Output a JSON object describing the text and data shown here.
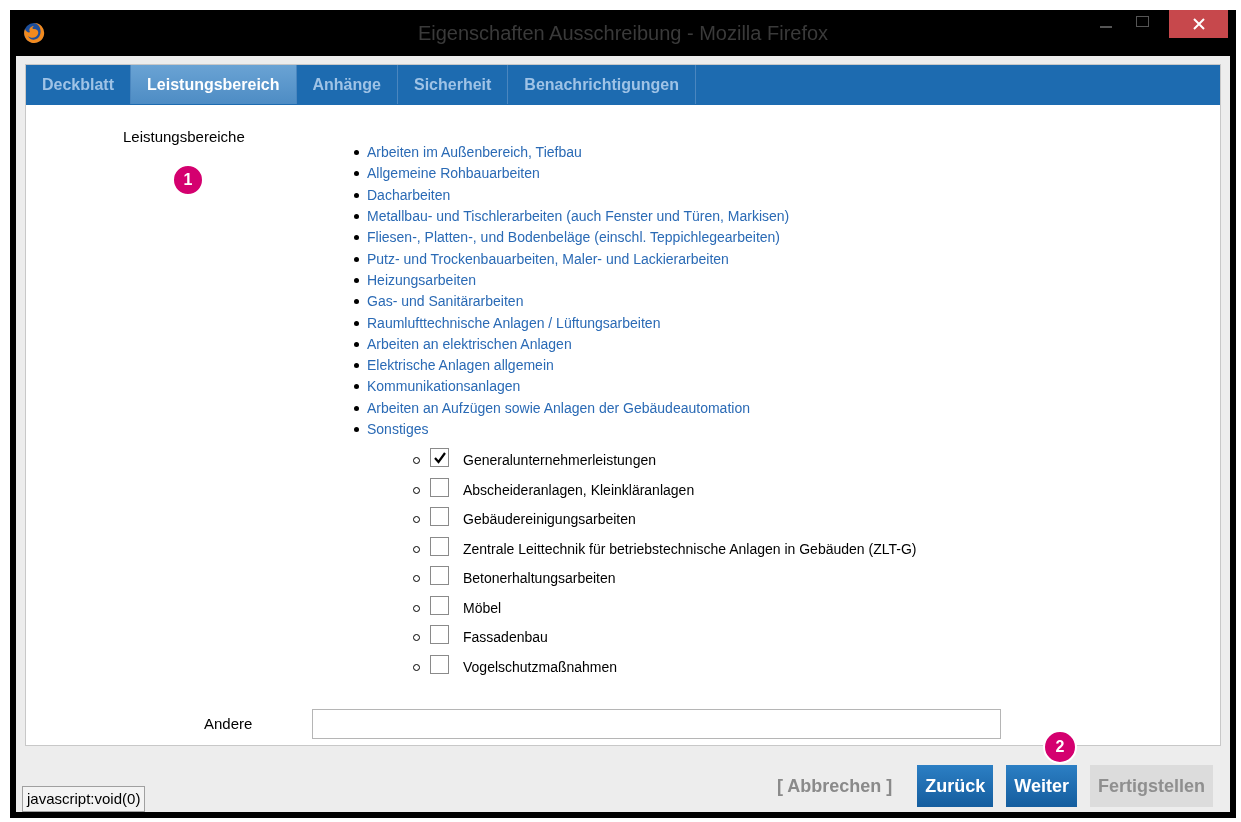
{
  "window": {
    "title": "Eigenschaften Ausschreibung - Mozilla Firefox"
  },
  "tabs": [
    {
      "label": "Deckblatt",
      "selected": false
    },
    {
      "label": "Leistungsbereich",
      "selected": true
    },
    {
      "label": "Anhänge",
      "selected": false
    },
    {
      "label": "Sicherheit",
      "selected": false
    },
    {
      "label": "Benachrichtigungen",
      "selected": false
    }
  ],
  "section_label": "Leistungsbereiche",
  "categories": [
    {
      "label": "Arbeiten im Außenbereich, Tiefbau"
    },
    {
      "label": "Allgemeine Rohbauarbeiten"
    },
    {
      "label": "Dacharbeiten"
    },
    {
      "label": "Metallbau- und Tischlerarbeiten (auch Fenster und Türen, Markisen)"
    },
    {
      "label": "Fliesen-, Platten-, und Bodenbeläge (einschl. Teppichlegearbeiten)"
    },
    {
      "label": "Putz- und Trockenbauarbeiten, Maler- und Lackierarbeiten"
    },
    {
      "label": "Heizungsarbeiten"
    },
    {
      "label": "Gas- und Sanitärarbeiten"
    },
    {
      "label": "Raumlufttechnische Anlagen / Lüftungsarbeiten"
    },
    {
      "label": "Arbeiten an elektrischen Anlagen"
    },
    {
      "label": "Elektrische Anlagen allgemein"
    },
    {
      "label": "Kommunikationsanlagen"
    },
    {
      "label": "Arbeiten an Aufzügen sowie Anlagen der Gebäudeautomation"
    },
    {
      "label": "Sonstiges",
      "children": [
        {
          "label": "Generalunternehmerleistungen",
          "checked": true
        },
        {
          "label": "Abscheideranlagen, Kleinkläranlagen",
          "checked": false
        },
        {
          "label": "Gebäudereinigungsarbeiten",
          "checked": false
        },
        {
          "label": "Zentrale Leittechnik für betriebstechnische Anlagen in Gebäuden (ZLT-G)",
          "checked": false
        },
        {
          "label": "Betonerhaltungsarbeiten",
          "checked": false
        },
        {
          "label": "Möbel",
          "checked": false
        },
        {
          "label": "Fassadenbau",
          "checked": false
        },
        {
          "label": "Vogelschutzmaßnahmen",
          "checked": false
        }
      ]
    }
  ],
  "other_field": {
    "label": "Andere"
  },
  "buttons": [
    {
      "label": "[ Abbrechen ]",
      "kind": "link",
      "disabled": false
    },
    {
      "label": "Zurück",
      "kind": "primary",
      "disabled": false
    },
    {
      "label": "Weiter",
      "kind": "primary",
      "disabled": false
    },
    {
      "label": "Fertigstellen",
      "kind": "primary",
      "disabled": true
    }
  ],
  "status_tooltip": "javascript:void(0)",
  "callouts": [
    {
      "label": "1"
    },
    {
      "label": "2"
    }
  ]
}
